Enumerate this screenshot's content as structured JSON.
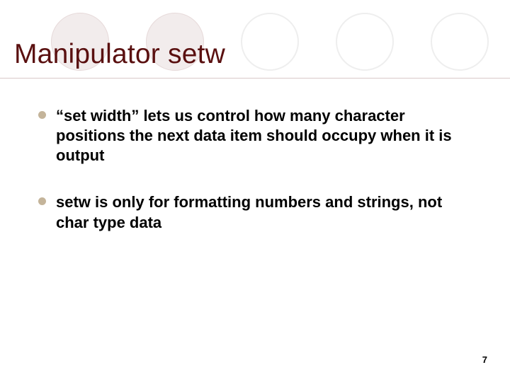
{
  "title": "Manipulator setw",
  "bullets": [
    "“set width” lets us control how many character positions the next data item should occupy when it is output",
    "setw is only for formatting numbers and strings, not char type data"
  ],
  "page_number": "7"
}
